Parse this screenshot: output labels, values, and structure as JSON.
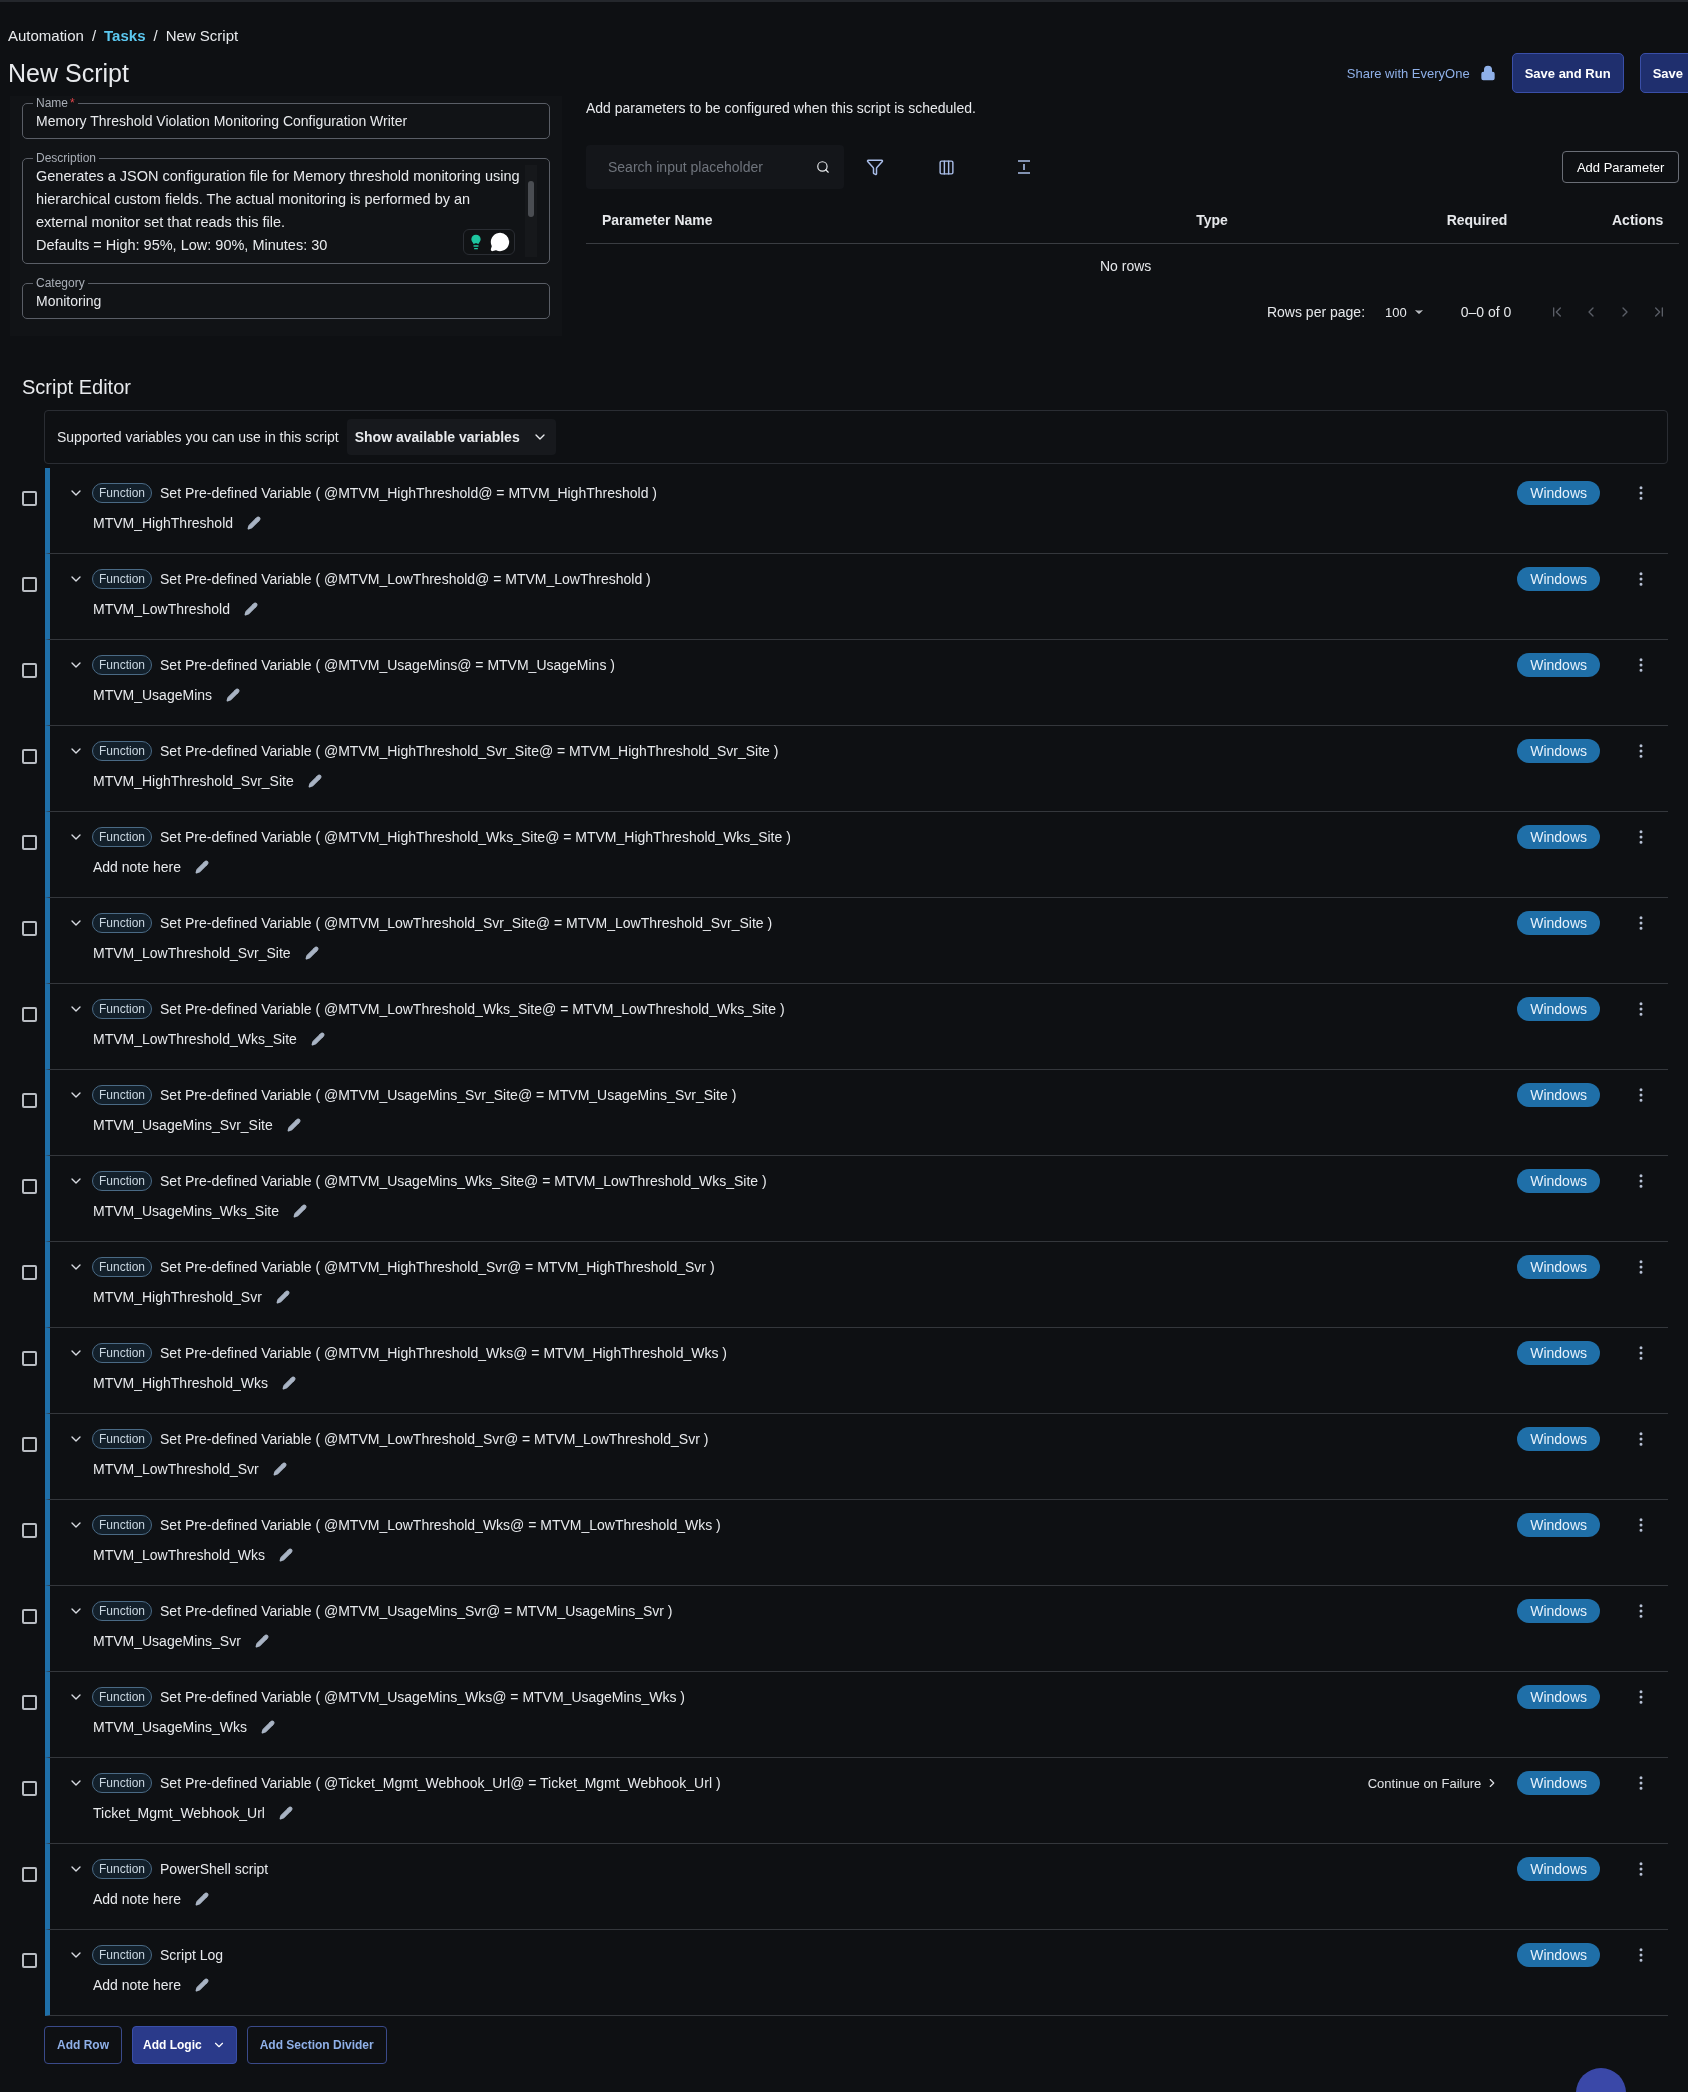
{
  "breadcrumb": {
    "separator": "/",
    "items": [
      {
        "label": "Automation",
        "kind": "text"
      },
      {
        "label": "Tasks",
        "kind": "link"
      },
      {
        "label": "New Script",
        "kind": "text"
      }
    ]
  },
  "title": "New Script",
  "header_actions": {
    "share": "Share with EveryOne",
    "buttons": [
      "Save and Run",
      "Save"
    ]
  },
  "form": {
    "name": {
      "label": "Name",
      "required_mark": "*",
      "value": "Memory Threshold Violation Monitoring Configuration Writer"
    },
    "description": {
      "label": "Description",
      "value": "Generates a JSON configuration file for Memory threshold monitoring using hierarchical custom fields. The actual monitoring is performed by an external monitor set that reads this file.\nDefaults = High: 95%, Low: 90%, Minutes: 30"
    },
    "category": {
      "label": "Category",
      "value": "Monitoring"
    }
  },
  "parameters": {
    "intro": "Add parameters to be configured when this script is scheduled.",
    "search": {
      "placeholder": "Search input placeholder"
    },
    "add_button": "Add Parameter",
    "columns": [
      "Parameter Name",
      "Type",
      "Required",
      "Actions"
    ],
    "empty": "No rows",
    "pagination": {
      "rows_label": "Rows per page:",
      "rows_value": "100",
      "range": "0–0 of 0"
    }
  },
  "script_editor": {
    "title": "Script Editor",
    "variables_text": "Supported variables you can use in this script",
    "variables_button": "Show available variables",
    "rows": [
      {
        "checked": false,
        "expanded": true,
        "tag": "Function",
        "title": "Set Pre-defined Variable ( @MTVM_HighThreshold@ = MTVM_HighThreshold )",
        "note": "MTVM_HighThreshold",
        "platform": "Windows"
      },
      {
        "checked": false,
        "expanded": true,
        "tag": "Function",
        "title": "Set Pre-defined Variable ( @MTVM_LowThreshold@ = MTVM_LowThreshold )",
        "note": "MTVM_LowThreshold",
        "platform": "Windows"
      },
      {
        "checked": false,
        "expanded": true,
        "tag": "Function",
        "title": "Set Pre-defined Variable ( @MTVM_UsageMins@ = MTVM_UsageMins )",
        "note": "MTVM_UsageMins",
        "platform": "Windows"
      },
      {
        "checked": false,
        "expanded": true,
        "tag": "Function",
        "title": "Set Pre-defined Variable ( @MTVM_HighThreshold_Svr_Site@ = MTVM_HighThreshold_Svr_Site )",
        "note": "MTVM_HighThreshold_Svr_Site",
        "platform": "Windows"
      },
      {
        "checked": false,
        "expanded": true,
        "tag": "Function",
        "title": "Set Pre-defined Variable ( @MTVM_HighThreshold_Wks_Site@ = MTVM_HighThreshold_Wks_Site )",
        "note": "Add note here",
        "platform": "Windows"
      },
      {
        "checked": false,
        "expanded": true,
        "tag": "Function",
        "title": "Set Pre-defined Variable ( @MTVM_LowThreshold_Svr_Site@ = MTVM_LowThreshold_Svr_Site )",
        "note": "MTVM_LowThreshold_Svr_Site",
        "platform": "Windows"
      },
      {
        "checked": false,
        "expanded": true,
        "tag": "Function",
        "title": "Set Pre-defined Variable ( @MTVM_LowThreshold_Wks_Site@ = MTVM_LowThreshold_Wks_Site )",
        "note": "MTVM_LowThreshold_Wks_Site",
        "platform": "Windows"
      },
      {
        "checked": false,
        "expanded": true,
        "tag": "Function",
        "title": "Set Pre-defined Variable ( @MTVM_UsageMins_Svr_Site@ = MTVM_UsageMins_Svr_Site )",
        "note": "MTVM_UsageMins_Svr_Site",
        "platform": "Windows"
      },
      {
        "checked": false,
        "expanded": true,
        "tag": "Function",
        "title": "Set Pre-defined Variable ( @MTVM_UsageMins_Wks_Site@ = MTVM_LowThreshold_Wks_Site )",
        "note": "MTVM_UsageMins_Wks_Site",
        "platform": "Windows"
      },
      {
        "checked": false,
        "expanded": true,
        "tag": "Function",
        "title": "Set Pre-defined Variable ( @MTVM_HighThreshold_Svr@ = MTVM_HighThreshold_Svr )",
        "note": "MTVM_HighThreshold_Svr",
        "platform": "Windows"
      },
      {
        "checked": false,
        "expanded": true,
        "tag": "Function",
        "title": "Set Pre-defined Variable ( @MTVM_HighThreshold_Wks@ = MTVM_HighThreshold_Wks )",
        "note": "MTVM_HighThreshold_Wks",
        "platform": "Windows"
      },
      {
        "checked": false,
        "expanded": true,
        "tag": "Function",
        "title": "Set Pre-defined Variable ( @MTVM_LowThreshold_Svr@ = MTVM_LowThreshold_Svr )",
        "note": "MTVM_LowThreshold_Svr",
        "platform": "Windows"
      },
      {
        "checked": false,
        "expanded": true,
        "tag": "Function",
        "title": "Set Pre-defined Variable ( @MTVM_LowThreshold_Wks@ = MTVM_LowThreshold_Wks )",
        "note": "MTVM_LowThreshold_Wks",
        "platform": "Windows"
      },
      {
        "checked": false,
        "expanded": true,
        "tag": "Function",
        "title": "Set Pre-defined Variable ( @MTVM_UsageMins_Svr@ = MTVM_UsageMins_Svr )",
        "note": "MTVM_UsageMins_Svr",
        "platform": "Windows"
      },
      {
        "checked": false,
        "expanded": true,
        "tag": "Function",
        "title": "Set Pre-defined Variable ( @MTVM_UsageMins_Wks@ = MTVM_UsageMins_Wks )",
        "note": "MTVM_UsageMins_Wks",
        "platform": "Windows"
      },
      {
        "checked": false,
        "expanded": true,
        "tag": "Function",
        "title": "Set Pre-defined Variable ( @Ticket_Mgmt_Webhook_Url@ = Ticket_Mgmt_Webhook_Url )",
        "note": "Ticket_Mgmt_Webhook_Url",
        "platform": "Windows",
        "failure_action": "Continue on Failure"
      },
      {
        "checked": false,
        "expanded": true,
        "tag": "Function",
        "title": "PowerShell script",
        "note": "Add note here",
        "platform": "Windows"
      },
      {
        "checked": false,
        "expanded": true,
        "tag": "Function",
        "title": "Script Log",
        "note": "Add note here",
        "platform": "Windows"
      }
    ],
    "actions": [
      {
        "label": "Add Row",
        "kind": "outline"
      },
      {
        "label": "Add Logic",
        "kind": "menu"
      },
      {
        "label": "Add Section Divider",
        "kind": "outline"
      }
    ]
  }
}
